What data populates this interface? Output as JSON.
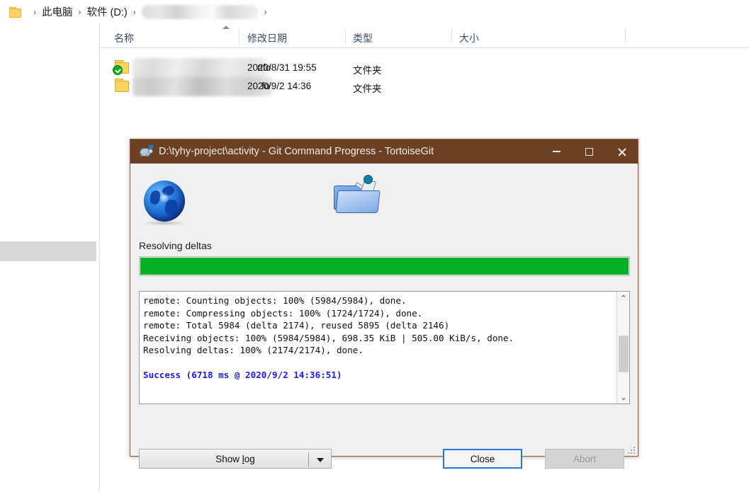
{
  "explorer": {
    "breadcrumb": {
      "folder_icon": "folder-icon",
      "separator": "›",
      "items": [
        {
          "label": "此电脑",
          "redacted": false
        },
        {
          "label": "软件 (D:)",
          "redacted": false
        },
        {
          "label": "",
          "redacted": true
        }
      ]
    },
    "columns": [
      {
        "key": "name",
        "label": "名称",
        "sorted": "asc"
      },
      {
        "key": "date",
        "label": "修改日期"
      },
      {
        "key": "type",
        "label": "类型"
      },
      {
        "key": "size",
        "label": "大小"
      }
    ],
    "rows": [
      {
        "name_tail": "nfo",
        "name_redacted": true,
        "status": "checked",
        "date": "2020/8/31 19:55",
        "type": "文件夹",
        "size": ""
      },
      {
        "name_tail": "fo",
        "name_redacted": true,
        "status": "none",
        "date": "2020/9/2 14:36",
        "type": "文件夹",
        "size": ""
      }
    ]
  },
  "dialog": {
    "title": "D:\\tyhy-project\\activity - Git Command Progress - TortoiseGit",
    "app_icon": "tortoise-icon",
    "window_buttons": {
      "minimize": "minimize-icon",
      "maximize": "maximize-icon",
      "close": "close-icon"
    },
    "icons": {
      "left": "globe-icon",
      "right": "folder-person-icon"
    },
    "status_text": "Resolving deltas",
    "progress": {
      "percent": 100,
      "color": "#06b025"
    },
    "log": {
      "lines": [
        "remote: Counting objects: 100% (5984/5984), done.",
        "remote: Compressing objects: 100% (1724/1724), done.",
        "remote: Total 5984 (delta 2174), reused 5895 (delta 2146)",
        "Receiving objects: 100% (5984/5984), 698.35 KiB | 505.00 KiB/s, done.",
        "Resolving deltas: 100% (2174/2174), done."
      ],
      "blank_line": "",
      "success_line": "Success (6718 ms @ 2020/9/2 14:36:51)",
      "success_color": "#1c1ce0",
      "scroll_up_glyph": "⌃",
      "scroll_down_glyph": "⌄"
    },
    "buttons": {
      "show_log": {
        "label": "Show log",
        "enabled": true,
        "has_dropdown": true
      },
      "close": {
        "label": "Close",
        "enabled": true,
        "default": true
      },
      "abort": {
        "label": "Abort",
        "enabled": false
      }
    }
  }
}
